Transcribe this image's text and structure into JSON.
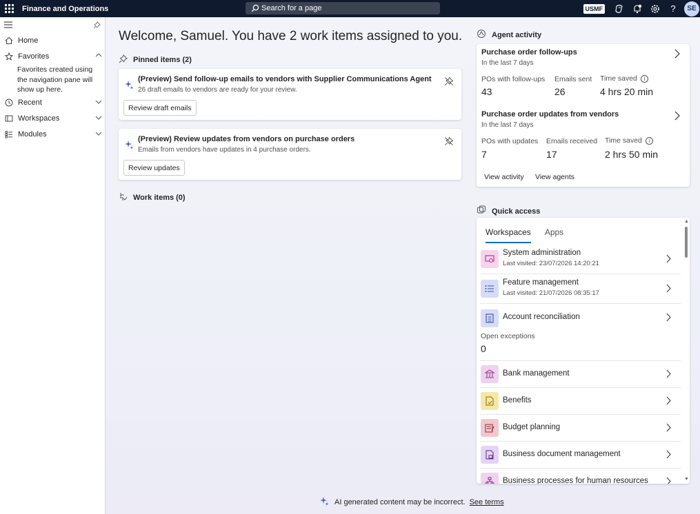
{
  "topbar": {
    "app_title": "Finance and Operations",
    "search_placeholder": "Search for a page",
    "company": "USMF",
    "avatar_initials": "SE",
    "icons": [
      "waffle-icon",
      "copilot-icon",
      "notifications-icon",
      "settings-icon",
      "help-icon"
    ]
  },
  "sidebar": {
    "home": "Home",
    "favorites": "Favorites",
    "favorites_note": "Favorites created using the navigation pane will show up here.",
    "recent": "Recent",
    "workspaces": "Workspaces",
    "modules": "Modules"
  },
  "main": {
    "welcome": "Welcome, Samuel. You have 2 work items assigned to you.",
    "pinned_header": "Pinned items (2)",
    "pinned": [
      {
        "title": "(Preview) Send follow-up emails to vendors with Supplier Communications Agent",
        "subtitle": "26 draft emails to vendors are ready for your review.",
        "button": "Review draft emails"
      },
      {
        "title": "(Preview) Review updates from vendors on purchase orders",
        "subtitle": "Emails from vendors have updates in 4 purchase orders.",
        "button": "Review updates"
      }
    ],
    "work_items_header": "Work items (0)"
  },
  "agent": {
    "header": "Agent activity",
    "sections": [
      {
        "title": "Purchase order follow-ups",
        "subtitle": "In the last 7 days",
        "m1_label": "POs with follow-ups",
        "m1_value": "43",
        "m2_label": "Emails sent",
        "m2_value": "26",
        "m3_label": "Time saved",
        "m3_value": "4 hrs 20 min"
      },
      {
        "title": "Purchase order updates from vendors",
        "subtitle": "In the last 7 days",
        "m1_label": "POs with updates",
        "m1_value": "7",
        "m2_label": "Emails received",
        "m2_value": "17",
        "m3_label": "Time saved",
        "m3_value": "2 hrs 50 min"
      }
    ],
    "view_activity": "View activity",
    "view_agents": "View agents"
  },
  "quick_access": {
    "header": "Quick access",
    "tabs": [
      "Workspaces",
      "Apps"
    ],
    "items": [
      {
        "name": "System administration",
        "sub": "Last visited: 23/07/2026 14:20:21",
        "icon": "system-admin-icon",
        "color": "#f7d3ee"
      },
      {
        "name": "Feature management",
        "sub": "Last visited: 21/07/2026 08:35:17",
        "icon": "feature-management-icon",
        "color": "#d6dcf7"
      },
      {
        "name": "Account reconciliation",
        "icon": "account-reconciliation-icon",
        "color": "#d6dcf7",
        "extra_label": "Open exceptions",
        "extra_value": "0"
      },
      {
        "name": "Bank management",
        "icon": "bank-icon",
        "color": "#efd2ee"
      },
      {
        "name": "Benefits",
        "icon": "benefits-icon",
        "color": "#f5e7a6"
      },
      {
        "name": "Budget planning",
        "icon": "budget-icon",
        "color": "#efc9cf"
      },
      {
        "name": "Business document management",
        "icon": "document-icon",
        "color": "#e3d5f3"
      },
      {
        "name": "Business processes for human resources",
        "icon": "process-icon",
        "color": "#efd2ee"
      }
    ]
  },
  "footer": {
    "note": "AI generated content may be incorrect.",
    "link": "See terms"
  },
  "colors": {
    "topbar": "#0f1a2e",
    "accent": "#0f6cbd",
    "sparkle": "#3b5cd6"
  }
}
